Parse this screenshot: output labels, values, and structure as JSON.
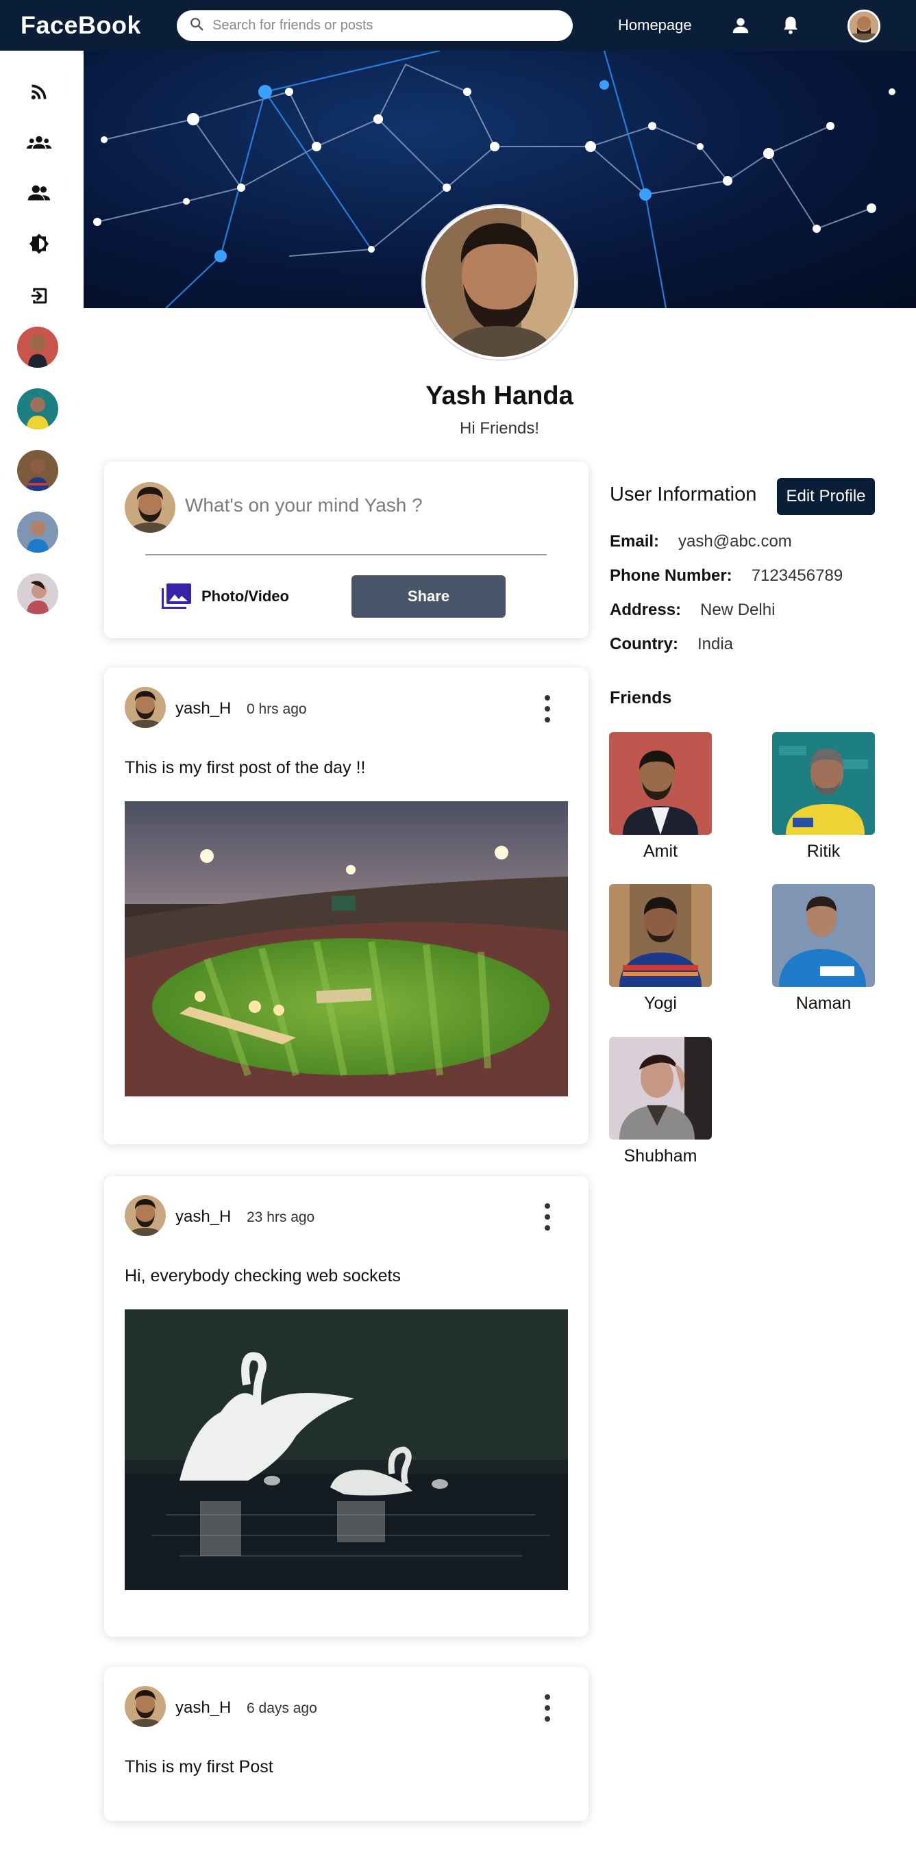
{
  "app": {
    "title": "FaceBook"
  },
  "search": {
    "placeholder": "Search for friends or posts"
  },
  "nav": {
    "homepage": "Homepage"
  },
  "profile": {
    "name": "Yash Handa",
    "bio": "Hi Friends!"
  },
  "share": {
    "placeholder": "What's on your mind Yash ?",
    "media_label": "Photo/Video",
    "share_label": "Share"
  },
  "posts": [
    {
      "user": "yash_H",
      "time": "0 hrs ago",
      "text": "This is my first post of the day !!",
      "image": "cricket-stadium"
    },
    {
      "user": "yash_H",
      "time": "23 hrs ago",
      "text": "Hi, everybody checking web sockets",
      "image": "swans-lake"
    },
    {
      "user": "yash_H",
      "time": "6 days ago",
      "text": "This is my first Post"
    }
  ],
  "user_info": {
    "title": "User Information",
    "edit_label": "Edit Profile",
    "rows": [
      {
        "key": "Email:",
        "value": "yash@abc.com"
      },
      {
        "key": "Phone Number:",
        "value": "7123456789"
      },
      {
        "key": "Address:",
        "value": "New Delhi"
      },
      {
        "key": "Country:",
        "value": "India"
      }
    ]
  },
  "friends": {
    "title": "Friends",
    "list": [
      {
        "name": "Amit"
      },
      {
        "name": "Ritik"
      },
      {
        "name": "Yogi"
      },
      {
        "name": "Naman"
      },
      {
        "name": "Shubham"
      }
    ]
  },
  "sidebar_icons": [
    "rss-feed-icon",
    "groups-icon",
    "friends-icon",
    "brightness-icon",
    "logout-icon"
  ],
  "colors": {
    "topbar": "#0b1e37",
    "share_button": "#4a5569",
    "media_icon": "#3a23a8"
  }
}
